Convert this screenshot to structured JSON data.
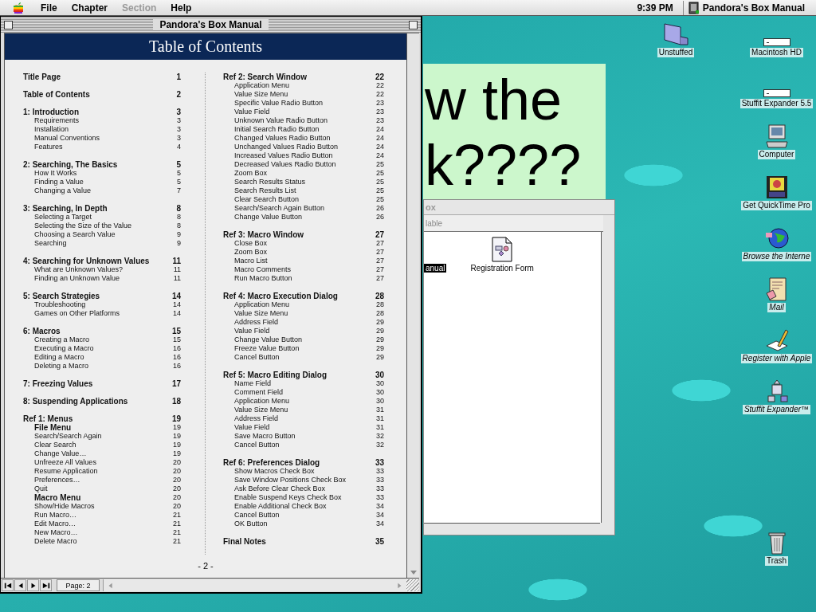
{
  "menu_bar": {
    "items": [
      {
        "label": "File",
        "disabled": false
      },
      {
        "label": "Chapter",
        "disabled": false
      },
      {
        "label": "Section",
        "disabled": true
      },
      {
        "label": "Help",
        "disabled": false
      }
    ],
    "clock": "9:39 PM",
    "app_name": "Pandora's Box Manual"
  },
  "background_window": {
    "lines": [
      "w the",
      "k????"
    ]
  },
  "finder_window": {
    "title": "ox",
    "header": "lable",
    "items": [
      {
        "name": "anual",
        "selected": true
      },
      {
        "name": "Registration Form",
        "selected": false
      }
    ]
  },
  "desktop_icons": [
    {
      "label": "Unstuffed",
      "kind": "item"
    },
    {
      "label": "Macintosh HD",
      "kind": "item"
    },
    {
      "label": "Stuffit Expander 5.5",
      "kind": "item"
    },
    {
      "label": "Computer",
      "kind": "item"
    },
    {
      "label": "Get QuickTime Pro",
      "kind": "item"
    },
    {
      "label": "Browse the Interne",
      "kind": "alias"
    },
    {
      "label": "Mail",
      "kind": "alias"
    },
    {
      "label": "Register with Apple",
      "kind": "alias"
    },
    {
      "label": "Stuffit Expander™",
      "kind": "alias"
    },
    {
      "label": "Trash",
      "kind": "item"
    }
  ],
  "manual_window": {
    "title": "Pandora's Box Manual",
    "header": "Table of Contents",
    "page_footer": "- 2 -",
    "page_field": "Page: 2",
    "columns": [
      [
        {
          "title": "Title Page",
          "page": "1"
        },
        {
          "title": "Table of Contents",
          "page": "2"
        },
        {
          "title": "1: Introduction",
          "page": "3",
          "children": [
            {
              "title": "Requirements",
              "page": "3",
              "kind": "entry"
            },
            {
              "title": "Installation",
              "page": "3",
              "kind": "entry"
            },
            {
              "title": "Manual Conventions",
              "page": "3",
              "kind": "entry"
            },
            {
              "title": "Features",
              "page": "4",
              "kind": "entry"
            }
          ]
        },
        {
          "title": "2: Searching, The Basics",
          "page": "5",
          "children": [
            {
              "title": "How It Works",
              "page": "5",
              "kind": "entry"
            },
            {
              "title": "Finding a Value",
              "page": "5",
              "kind": "entry"
            },
            {
              "title": "Changing a Value",
              "page": "7",
              "kind": "entry"
            }
          ]
        },
        {
          "title": "3: Searching, In Depth",
          "page": "8",
          "children": [
            {
              "title": "Selecting a Target",
              "page": "8",
              "kind": "entry"
            },
            {
              "title": "Selecting the Size of the Value",
              "page": "8",
              "kind": "entry"
            },
            {
              "title": "Choosing a Search Value",
              "page": "9",
              "kind": "entry"
            },
            {
              "title": "Searching",
              "page": "9",
              "kind": "entry"
            }
          ]
        },
        {
          "title": "4: Searching for Unknown Values",
          "page": "11",
          "children": [
            {
              "title": "What are Unknown Values?",
              "page": "11",
              "kind": "entry"
            },
            {
              "title": "Finding an Unknown Value",
              "page": "11",
              "kind": "entry"
            }
          ]
        },
        {
          "title": "5: Search Strategies",
          "page": "14",
          "children": [
            {
              "title": "Troubleshooting",
              "page": "14",
              "kind": "entry"
            },
            {
              "title": "Games on Other Platforms",
              "page": "14",
              "kind": "entry"
            }
          ]
        },
        {
          "title": "6: Macros",
          "page": "15",
          "children": [
            {
              "title": "Creating a Macro",
              "page": "15",
              "kind": "entry"
            },
            {
              "title": "Executing a Macro",
              "page": "16",
              "kind": "entry"
            },
            {
              "title": "Editing a Macro",
              "page": "16",
              "kind": "entry"
            },
            {
              "title": "Deleting a Macro",
              "page": "16",
              "kind": "entry"
            }
          ]
        },
        {
          "title": "7: Freezing Values",
          "page": "17"
        },
        {
          "title": "8: Suspending Applications",
          "page": "18"
        },
        {
          "title": "Ref 1: Menus",
          "page": "19",
          "children": [
            {
              "title": "File Menu",
              "page": "19",
              "kind": "subhead"
            },
            {
              "title": "Search/Search Again",
              "page": "19",
              "kind": "entry"
            },
            {
              "title": "Clear Search",
              "page": "19",
              "kind": "entry"
            },
            {
              "title": "Change Value…",
              "page": "19",
              "kind": "entry"
            },
            {
              "title": "Unfreeze All Values",
              "page": "20",
              "kind": "entry"
            },
            {
              "title": "Resume Application",
              "page": "20",
              "kind": "entry"
            },
            {
              "title": "Preferences…",
              "page": "20",
              "kind": "entry"
            },
            {
              "title": "Quit",
              "page": "20",
              "kind": "entry"
            },
            {
              "title": "Macro Menu",
              "page": "20",
              "kind": "subhead"
            },
            {
              "title": "Show/Hide Macros",
              "page": "20",
              "kind": "entry"
            },
            {
              "title": "Run Macro…",
              "page": "21",
              "kind": "entry"
            },
            {
              "title": "Edit Macro…",
              "page": "21",
              "kind": "entry"
            },
            {
              "title": "New Macro…",
              "page": "21",
              "kind": "entry"
            },
            {
              "title": "Delete Macro",
              "page": "21",
              "kind": "entry"
            }
          ]
        }
      ],
      [
        {
          "title": "Ref 2: Search Window",
          "page": "22",
          "children": [
            {
              "title": "Application Menu",
              "page": "22",
              "kind": "entry"
            },
            {
              "title": "Value Size Menu",
              "page": "22",
              "kind": "entry"
            },
            {
              "title": "Specific Value Radio Button",
              "page": "23",
              "kind": "entry"
            },
            {
              "title": "Value Field",
              "page": "23",
              "kind": "entry"
            },
            {
              "title": "Unknown Value Radio Button",
              "page": "23",
              "kind": "entry"
            },
            {
              "title": "Initial Search Radio Button",
              "page": "24",
              "kind": "entry"
            },
            {
              "title": "Changed Values Radio Button",
              "page": "24",
              "kind": "entry"
            },
            {
              "title": "Unchanged Values Radio Button",
              "page": "24",
              "kind": "entry"
            },
            {
              "title": "Increased Values Radio Button",
              "page": "24",
              "kind": "entry"
            },
            {
              "title": "Decreased Values Radio Button",
              "page": "25",
              "kind": "entry"
            },
            {
              "title": "Zoom Box",
              "page": "25",
              "kind": "entry"
            },
            {
              "title": "Search Results Status",
              "page": "25",
              "kind": "entry"
            },
            {
              "title": "Search Results List",
              "page": "25",
              "kind": "entry"
            },
            {
              "title": "Clear Search Button",
              "page": "25",
              "kind": "entry"
            },
            {
              "title": "Search/Search Again Button",
              "page": "26",
              "kind": "entry"
            },
            {
              "title": "Change Value Button",
              "page": "26",
              "kind": "entry"
            }
          ]
        },
        {
          "title": "Ref 3: Macro Window",
          "page": "27",
          "children": [
            {
              "title": "Close Box",
              "page": "27",
              "kind": "entry"
            },
            {
              "title": "Zoom Box",
              "page": "27",
              "kind": "entry"
            },
            {
              "title": "Macro List",
              "page": "27",
              "kind": "entry"
            },
            {
              "title": "Macro Comments",
              "page": "27",
              "kind": "entry"
            },
            {
              "title": "Run Macro Button",
              "page": "27",
              "kind": "entry"
            }
          ]
        },
        {
          "title": "Ref 4: Macro Execution Dialog",
          "page": "28",
          "children": [
            {
              "title": "Application Menu",
              "page": "28",
              "kind": "entry"
            },
            {
              "title": "Value Size Menu",
              "page": "28",
              "kind": "entry"
            },
            {
              "title": "Address Field",
              "page": "29",
              "kind": "entry"
            },
            {
              "title": "Value Field",
              "page": "29",
              "kind": "entry"
            },
            {
              "title": "Change Value Button",
              "page": "29",
              "kind": "entry"
            },
            {
              "title": "Freeze Value Button",
              "page": "29",
              "kind": "entry"
            },
            {
              "title": "Cancel Button",
              "page": "29",
              "kind": "entry"
            }
          ]
        },
        {
          "title": "Ref 5: Macro Editing Dialog",
          "page": "30",
          "children": [
            {
              "title": "Name Field",
              "page": "30",
              "kind": "entry"
            },
            {
              "title": "Comment Field",
              "page": "30",
              "kind": "entry"
            },
            {
              "title": "Application Menu",
              "page": "30",
              "kind": "entry"
            },
            {
              "title": "Value Size Menu",
              "page": "31",
              "kind": "entry"
            },
            {
              "title": "Address Field",
              "page": "31",
              "kind": "entry"
            },
            {
              "title": "Value Field",
              "page": "31",
              "kind": "entry"
            },
            {
              "title": "Save Macro Button",
              "page": "32",
              "kind": "entry"
            },
            {
              "title": "Cancel Button",
              "page": "32",
              "kind": "entry"
            }
          ]
        },
        {
          "title": "Ref 6: Preferences Dialog",
          "page": "33",
          "children": [
            {
              "title": "Show Macros Check Box",
              "page": "33",
              "kind": "entry"
            },
            {
              "title": "Save Window Positions Check Box",
              "page": "33",
              "kind": "entry"
            },
            {
              "title": "Ask Before Clear Check Box",
              "page": "33",
              "kind": "entry"
            },
            {
              "title": "Enable Suspend Keys Check Box",
              "page": "33",
              "kind": "entry"
            },
            {
              "title": "Enable Additional Check Box",
              "page": "34",
              "kind": "entry"
            },
            {
              "title": "Cancel Button",
              "page": "34",
              "kind": "entry"
            },
            {
              "title": "OK Button",
              "page": "34",
              "kind": "entry"
            }
          ]
        },
        {
          "title": "Final Notes",
          "page": "35"
        }
      ]
    ]
  }
}
